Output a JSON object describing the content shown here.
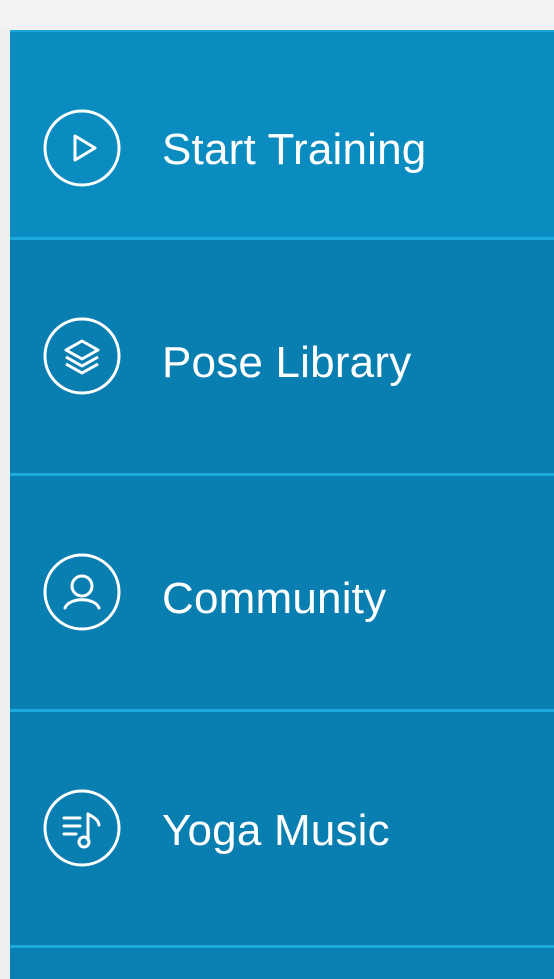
{
  "menu": {
    "items": [
      {
        "label": "Start Training",
        "icon": "play-icon"
      },
      {
        "label": "Pose Library",
        "icon": "layers-icon"
      },
      {
        "label": "Community",
        "icon": "user-icon"
      },
      {
        "label": "Yoga Music",
        "icon": "music-icon"
      }
    ]
  },
  "colors": {
    "panel": "#097eb1",
    "first_item": "#0a8cc0",
    "divider": "#1ca9db",
    "text": "#ffffff"
  }
}
